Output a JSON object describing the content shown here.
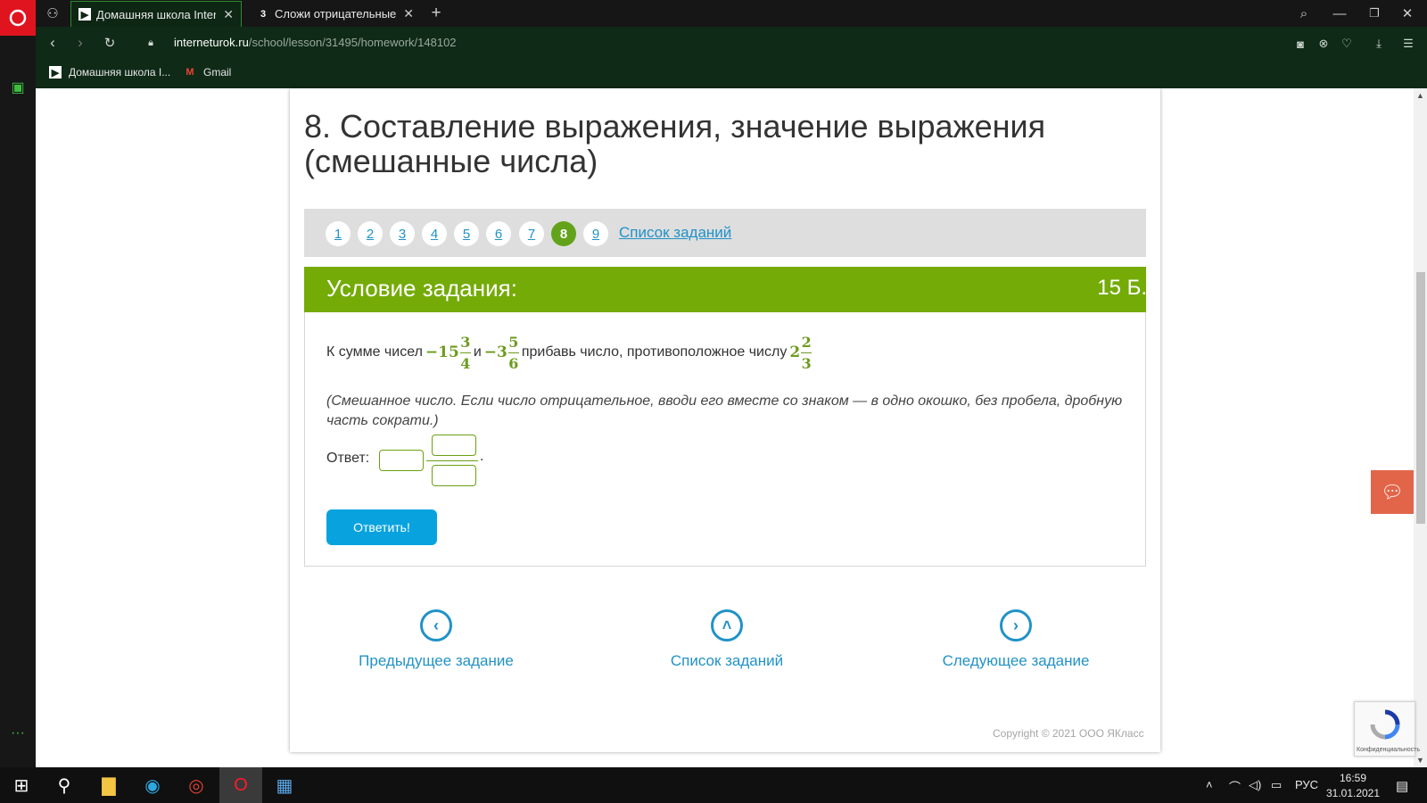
{
  "browser": {
    "tabs": [
      {
        "title": "Домашняя школа Interne",
        "active": true
      },
      {
        "title": "Сложи отрицательные см",
        "active": false
      }
    ],
    "new_tab": "+",
    "url_host": "interneturok.ru",
    "url_path": "/school/lesson/31495/homework/148102",
    "bookmarks": [
      {
        "label": "Домашняя школа I..."
      },
      {
        "label": "Gmail"
      }
    ]
  },
  "page": {
    "title_line1": "8. Составление выражения, значение выражения",
    "title_line2": "(смешанные числа)",
    "task_numbers": [
      "1",
      "2",
      "3",
      "4",
      "5",
      "6",
      "7",
      "8",
      "9"
    ],
    "current_task": "8",
    "task_list_link": "Список заданий",
    "condition_title": "Условие задания:",
    "points": "15 Б.",
    "task_text": {
      "part1": "К сумме чисел",
      "num1_whole": "−15",
      "num1_numer": "3",
      "num1_denom": "4",
      "conj": "и",
      "num2_whole": "−3",
      "num2_numer": "5",
      "num2_denom": "6",
      "part2": "прибавь число, противоположное числу",
      "num3_whole": "2",
      "num3_numer": "2",
      "num3_denom": "3"
    },
    "hint": "(Смешанное число. Если число отрицательное, вводи его вместе со знаком — в одно окошко, без пробела, дробную часть сократи.)",
    "answer_label": "Ответ:",
    "answer_dot": ".",
    "submit_label": "Ответить!",
    "nav": {
      "prev": "Предыдущее задание",
      "list": "Список заданий",
      "next": "Следующее задание"
    },
    "copyright": "Copyright © 2021 ООО ЯКласс",
    "recaptcha_text": "Конфиденциальность"
  },
  "taskbar": {
    "lang": "РУС",
    "time": "16:59",
    "date": "31.01.2021"
  },
  "colors": {
    "accent_green": "#74ab07",
    "link_blue": "#2192c8",
    "button_blue": "#08a3de"
  }
}
